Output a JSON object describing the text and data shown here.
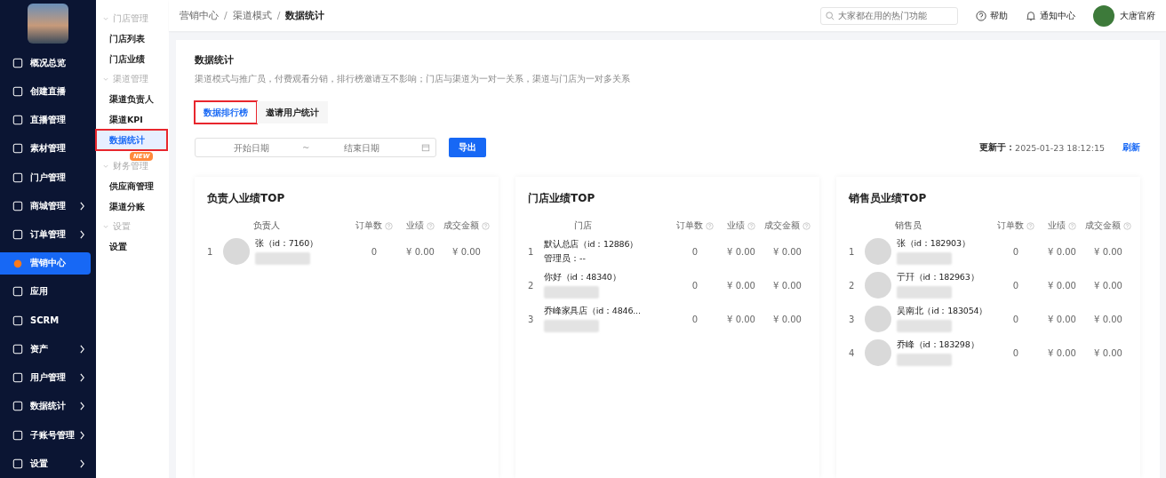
{
  "sidebar": {
    "items": [
      {
        "label": "概况总览",
        "expandable": false,
        "selected": false
      },
      {
        "label": "创建直播",
        "expandable": false,
        "selected": false
      },
      {
        "label": "直播管理",
        "expandable": false,
        "selected": false
      },
      {
        "label": "素材管理",
        "expandable": false,
        "selected": false
      },
      {
        "label": "门户管理",
        "expandable": false,
        "selected": false
      },
      {
        "label": "商城管理",
        "expandable": true,
        "selected": false
      },
      {
        "label": "订单管理",
        "expandable": true,
        "selected": false
      },
      {
        "label": "营销中心",
        "expandable": false,
        "selected": true
      },
      {
        "label": "应用",
        "expandable": false,
        "selected": false
      },
      {
        "label": "SCRM",
        "expandable": false,
        "selected": false
      },
      {
        "label": "资产",
        "expandable": true,
        "selected": false
      },
      {
        "label": "用户管理",
        "expandable": true,
        "selected": false
      },
      {
        "label": "数据统计",
        "expandable": true,
        "selected": false
      },
      {
        "label": "子账号管理",
        "expandable": true,
        "selected": false
      },
      {
        "label": "设置",
        "expandable": true,
        "selected": false
      }
    ]
  },
  "submenu": {
    "groups": [
      {
        "title": "门店管理",
        "expanded": true,
        "items": [
          {
            "label": "门店列表",
            "selected": false,
            "highlighted": false
          },
          {
            "label": "门店业绩",
            "selected": false,
            "highlighted": false
          }
        ]
      },
      {
        "title": "渠道管理",
        "expanded": true,
        "items": [
          {
            "label": "渠道负责人",
            "selected": false,
            "highlighted": false
          },
          {
            "label": "渠道KPI",
            "selected": false,
            "highlighted": false
          },
          {
            "label": "数据统计",
            "selected": true,
            "highlighted": true,
            "badge": "NEW"
          }
        ]
      },
      {
        "title": "财务管理",
        "expanded": true,
        "items": [
          {
            "label": "供应商管理",
            "selected": false,
            "highlighted": false
          },
          {
            "label": "渠道分账",
            "selected": false,
            "highlighted": false
          }
        ]
      },
      {
        "title": "设置",
        "expanded": true,
        "items": [
          {
            "label": "设置",
            "selected": false,
            "highlighted": false
          }
        ]
      }
    ]
  },
  "header": {
    "breadcrumb": [
      "营销中心",
      "渠道模式",
      "数据统计"
    ],
    "breadcrumb_separator": "/",
    "search": {
      "placeholder": "大家都在用的热门功能"
    },
    "help": "帮助",
    "notifications": "通知中心",
    "user": "大唐官府"
  },
  "page": {
    "title": "数据统计",
    "description": "渠道模式与推广员，付费观看分销，排行榜邀请互不影响；门店与渠道为一对一关系，渠道与门店为一对多关系",
    "tabs": [
      {
        "label": "数据排行榜",
        "selected": true,
        "highlighted": true
      },
      {
        "label": "邀请用户统计",
        "selected": false,
        "highlighted": false
      }
    ],
    "date_range": {
      "start_placeholder": "开始日期",
      "separator": "~",
      "end_placeholder": "结束日期"
    },
    "export_button": "导出",
    "updated_label": "更新于：",
    "updated_time": "2025-01-23 18:12:15",
    "refresh": "刷新",
    "panels": [
      {
        "title": "负责人业绩TOP",
        "columns": [
          {
            "label": "负责人",
            "help": false
          },
          {
            "label": "订单数",
            "help": true
          },
          {
            "label": "业绩",
            "help": true
          },
          {
            "label": "成交金额",
            "help": true
          }
        ],
        "rows": [
          {
            "rank": "1",
            "avatar": true,
            "name": "张（id：7160）",
            "redacted": true,
            "orders": "0",
            "performance": "¥ 0.00",
            "amount": "¥ 0.00"
          }
        ]
      },
      {
        "title": "门店业绩TOP",
        "columns": [
          {
            "label": "门店",
            "help": false
          },
          {
            "label": "订单数",
            "help": true
          },
          {
            "label": "业绩",
            "help": true
          },
          {
            "label": "成交金额",
            "help": true
          }
        ],
        "rows": [
          {
            "rank": "1",
            "avatar": false,
            "name": "默认总店（id：12886）",
            "subtitle": "管理员：--",
            "redacted": false,
            "orders": "0",
            "performance": "¥ 0.00",
            "amount": "¥ 0.00"
          },
          {
            "rank": "2",
            "avatar": false,
            "name": "你好（id：48340）",
            "redacted": true,
            "orders": "0",
            "performance": "¥ 0.00",
            "amount": "¥ 0.00"
          },
          {
            "rank": "3",
            "avatar": false,
            "name": "乔峰家具店（id：4846...",
            "redacted": true,
            "orders": "0",
            "performance": "¥ 0.00",
            "amount": "¥ 0.00"
          }
        ]
      },
      {
        "title": "销售员业绩TOP",
        "columns": [
          {
            "label": "销售员",
            "help": false
          },
          {
            "label": "订单数",
            "help": true
          },
          {
            "label": "业绩",
            "help": true
          },
          {
            "label": "成交金额",
            "help": true
          }
        ],
        "rows": [
          {
            "rank": "1",
            "avatar": true,
            "name": "张（id：182903）",
            "redacted": true,
            "orders": "0",
            "performance": "¥ 0.00",
            "amount": "¥ 0.00"
          },
          {
            "rank": "2",
            "avatar": true,
            "name": "亍幵（id：182963）",
            "redacted": true,
            "orders": "0",
            "performance": "¥ 0.00",
            "amount": "¥ 0.00"
          },
          {
            "rank": "3",
            "avatar": true,
            "name": "吴南北（id：183054）",
            "redacted": true,
            "orders": "0",
            "performance": "¥ 0.00",
            "amount": "¥ 0.00"
          },
          {
            "rank": "4",
            "avatar": true,
            "name": "乔峰（id：183298）",
            "redacted": true,
            "orders": "0",
            "performance": "¥ 0.00",
            "amount": "¥ 0.00"
          }
        ]
      }
    ]
  }
}
